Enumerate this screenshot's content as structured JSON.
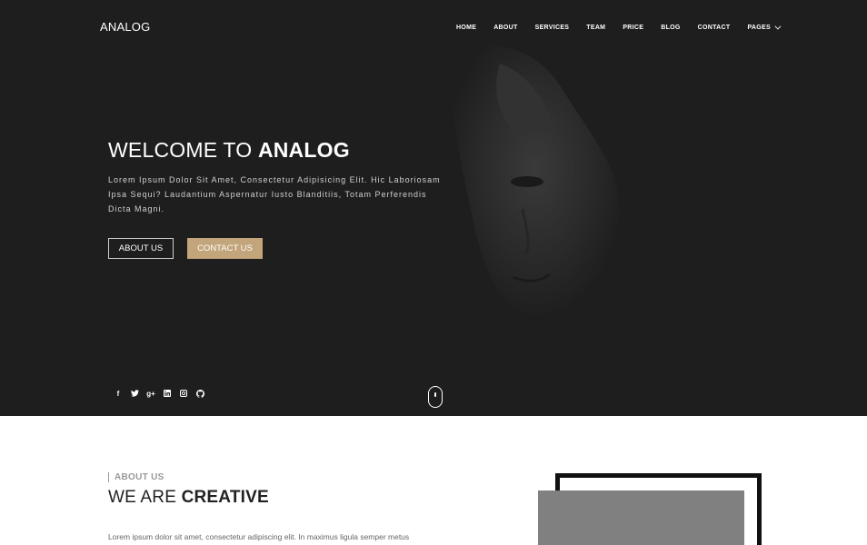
{
  "brand": {
    "name": "ANALOG"
  },
  "nav": {
    "items": [
      {
        "label": "HOME"
      },
      {
        "label": "ABOUT"
      },
      {
        "label": "SERVICES"
      },
      {
        "label": "TEAM"
      },
      {
        "label": "PRICE"
      },
      {
        "label": "BLOG"
      },
      {
        "label": "CONTACT"
      }
    ],
    "pages_label": "PAGES"
  },
  "hero": {
    "title_prefix": "WELCOME TO ",
    "title_emphasis": "ANALOG",
    "text": "Lorem Ipsum Dolor Sit Amet, Consectetur Adipisicing Elit. Hic Laboriosam Ipsa Sequi? Laudantium Aspernatur Iusto Blanditiis, Totam Perferendis Dicta Magni.",
    "about_button": "ABOUT US",
    "contact_button": "CONTACT US"
  },
  "social": {
    "icons": [
      "facebook-icon",
      "twitter-icon",
      "google-plus-icon",
      "linkedin-icon",
      "instagram-icon",
      "github-icon"
    ],
    "facebook": "f",
    "google_plus": "g+"
  },
  "about": {
    "subtitle": "ABOUT US",
    "title_prefix": "WE ARE ",
    "title_emphasis": "CREATIVE",
    "text": "Lorem ipsum dolor sit amet, consectetur adipiscing elit. In maximus ligula semper metus"
  },
  "colors": {
    "hero_bg": "#1e1e1e",
    "accent": "#c2a57a",
    "image_placeholder": "#808080",
    "frame": "#111111"
  }
}
